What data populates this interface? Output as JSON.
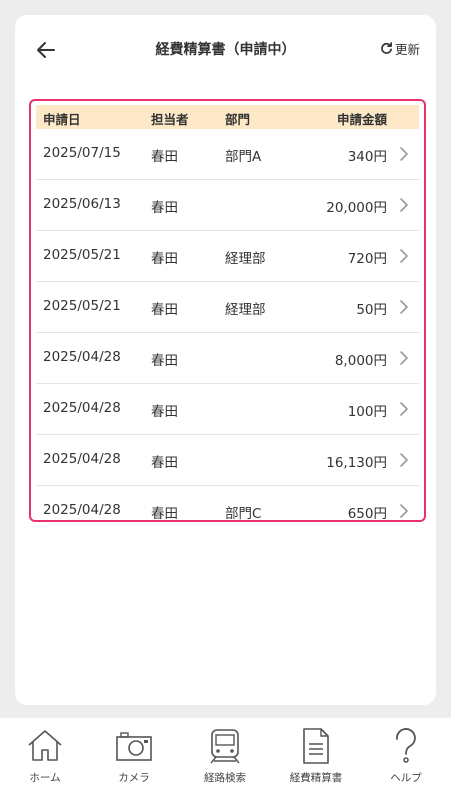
{
  "header": {
    "title": "経費精算書（申請中）",
    "refresh_label": "更新"
  },
  "table": {
    "columns": {
      "date": "申請日",
      "staff": "担当者",
      "dept": "部門",
      "amount": "申請金額"
    },
    "rows": [
      {
        "date": "2025/07/15",
        "staff": "春田",
        "dept": "部門A",
        "amount": "340円"
      },
      {
        "date": "2025/06/13",
        "staff": "春田",
        "dept": "",
        "amount": "20,000円"
      },
      {
        "date": "2025/05/21",
        "staff": "春田",
        "dept": "経理部",
        "amount": "720円"
      },
      {
        "date": "2025/05/21",
        "staff": "春田",
        "dept": "経理部",
        "amount": "50円"
      },
      {
        "date": "2025/04/28",
        "staff": "春田",
        "dept": "",
        "amount": "8,000円"
      },
      {
        "date": "2025/04/28",
        "staff": "春田",
        "dept": "",
        "amount": "100円"
      },
      {
        "date": "2025/04/28",
        "staff": "春田",
        "dept": "",
        "amount": "16,130円"
      },
      {
        "date": "2025/04/28",
        "staff": "春田",
        "dept": "部門C",
        "amount": "650円"
      }
    ]
  },
  "nav": {
    "items": [
      {
        "label": "ホーム",
        "icon": "home-icon"
      },
      {
        "label": "カメラ",
        "icon": "camera-icon"
      },
      {
        "label": "経路検索",
        "icon": "train-icon"
      },
      {
        "label": "経費精算書",
        "icon": "document-icon"
      },
      {
        "label": "ヘルプ",
        "icon": "help-icon"
      }
    ]
  },
  "colors": {
    "highlight_border": "#e8336a",
    "table_header_bg": "#fde9c8",
    "background": "#ededed"
  }
}
